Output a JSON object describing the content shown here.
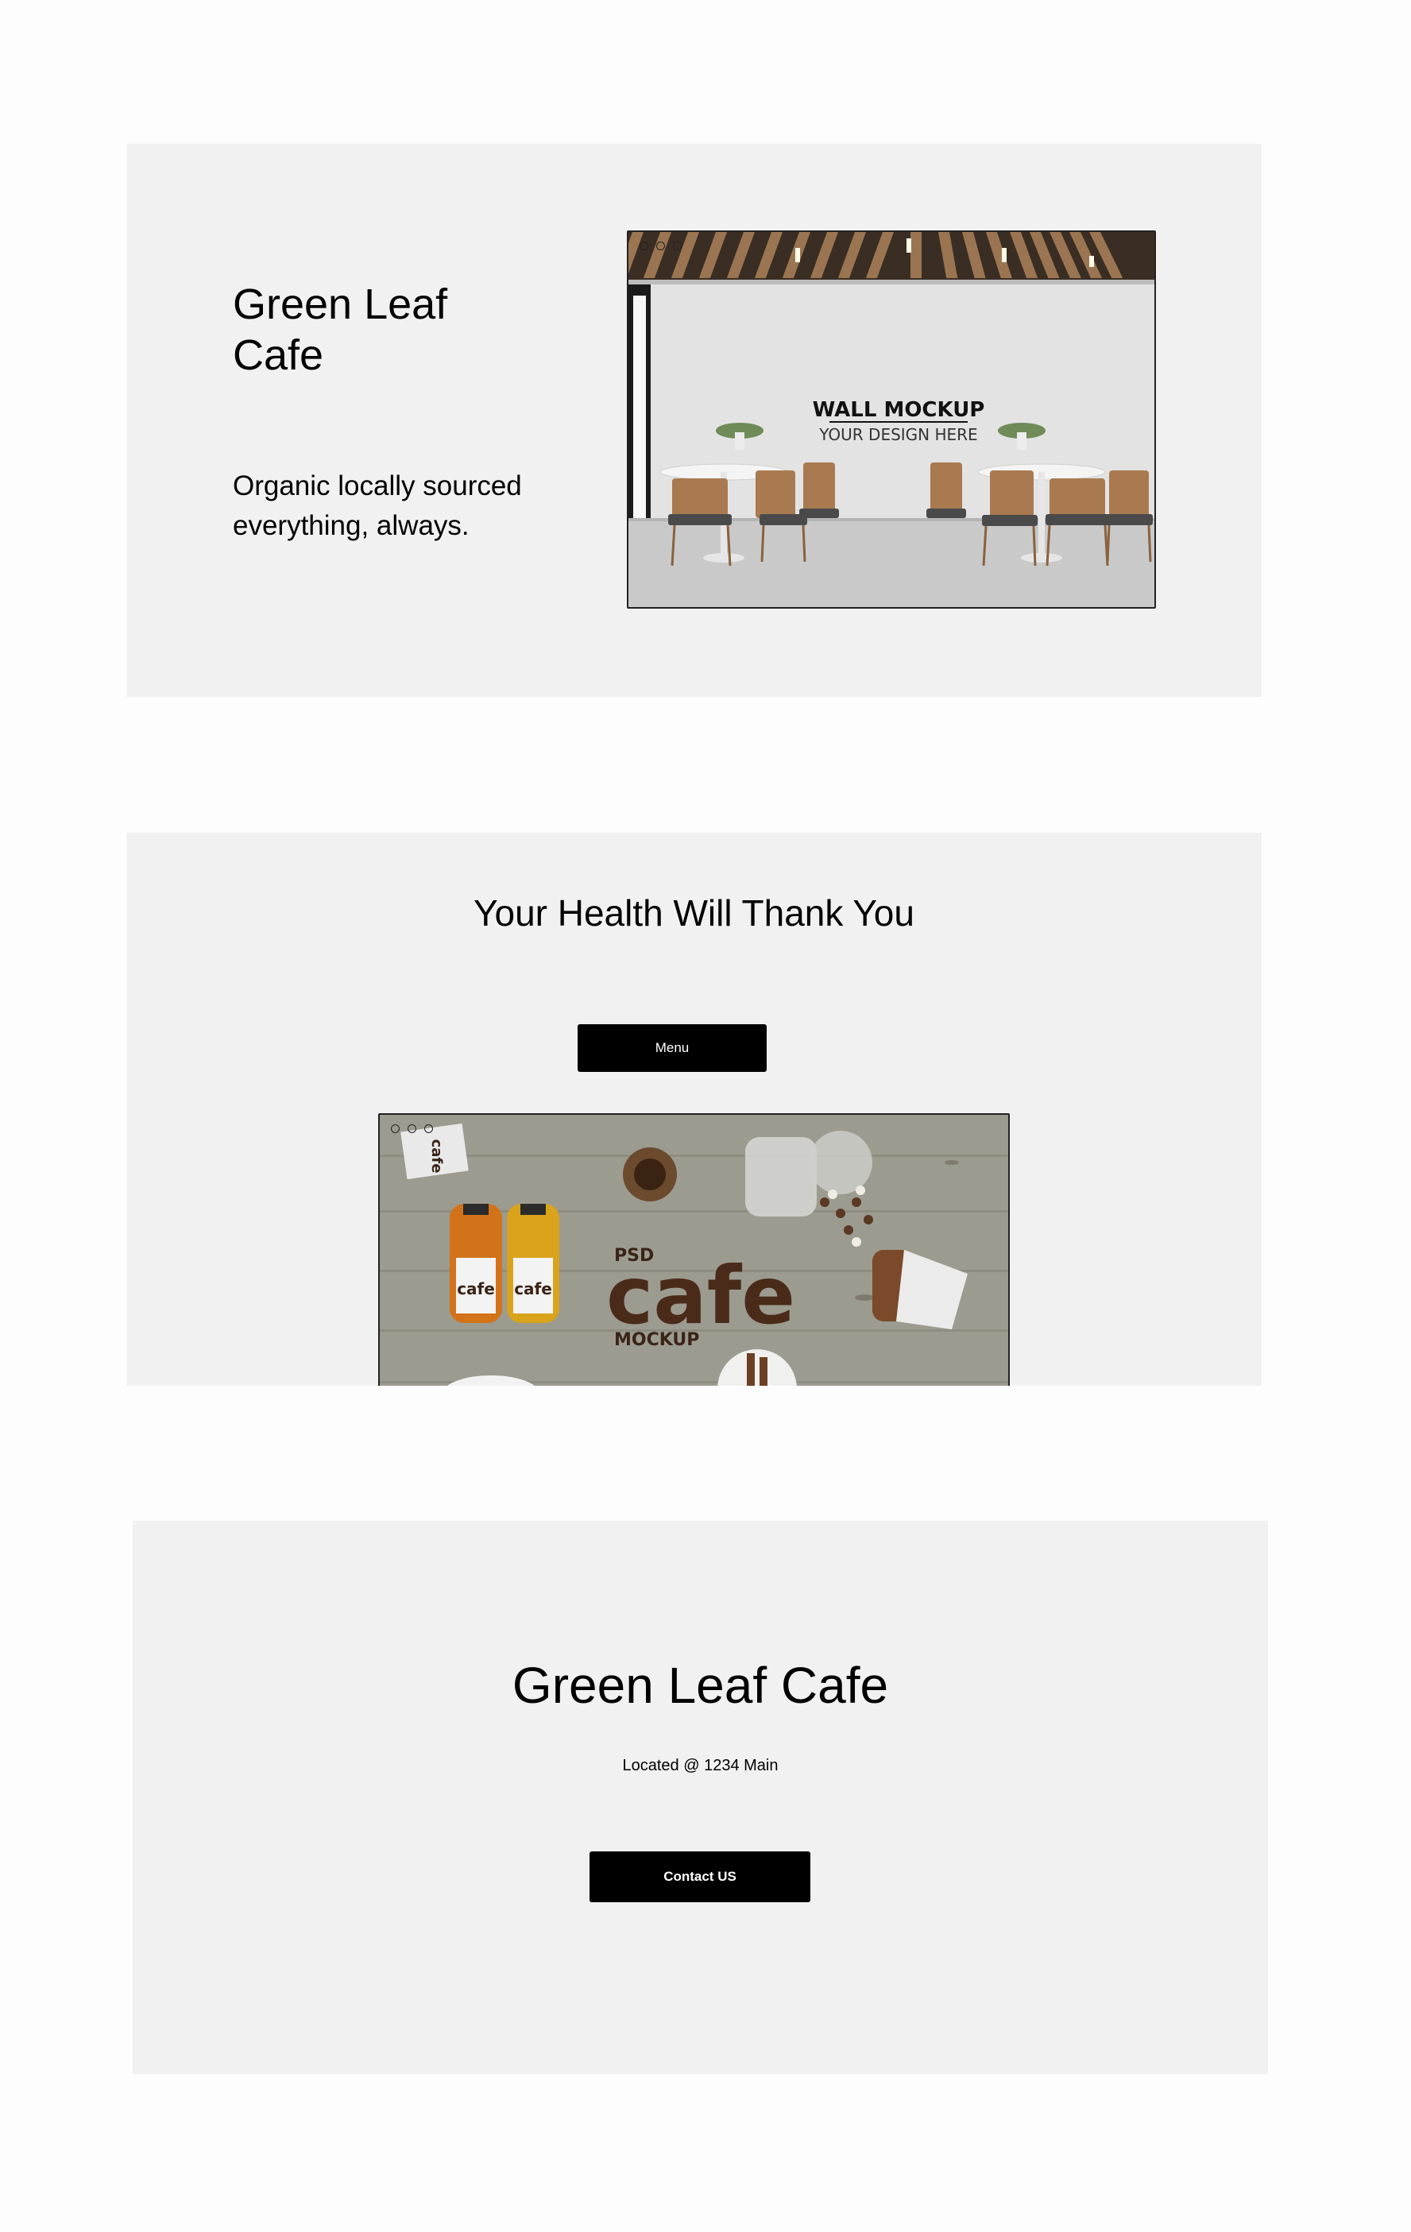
{
  "hero": {
    "title": "Green Leaf Cafe",
    "description": "Organic locally sourced everything, always.",
    "image": {
      "headline": "WALL MOCKUP",
      "subline": "YOUR DESIGN HERE"
    }
  },
  "health": {
    "heading": "Your Health Will Thank You",
    "menu_label": "Menu",
    "image": {
      "psd": "PSD",
      "word": "cafe",
      "mockup": "MOCKUP",
      "bottle_label": "cafe",
      "packet_label": "cafe"
    }
  },
  "contact": {
    "title": "Green Leaf Cafe",
    "location": "Located @ 1234 Main",
    "button_label": "Contact US"
  }
}
